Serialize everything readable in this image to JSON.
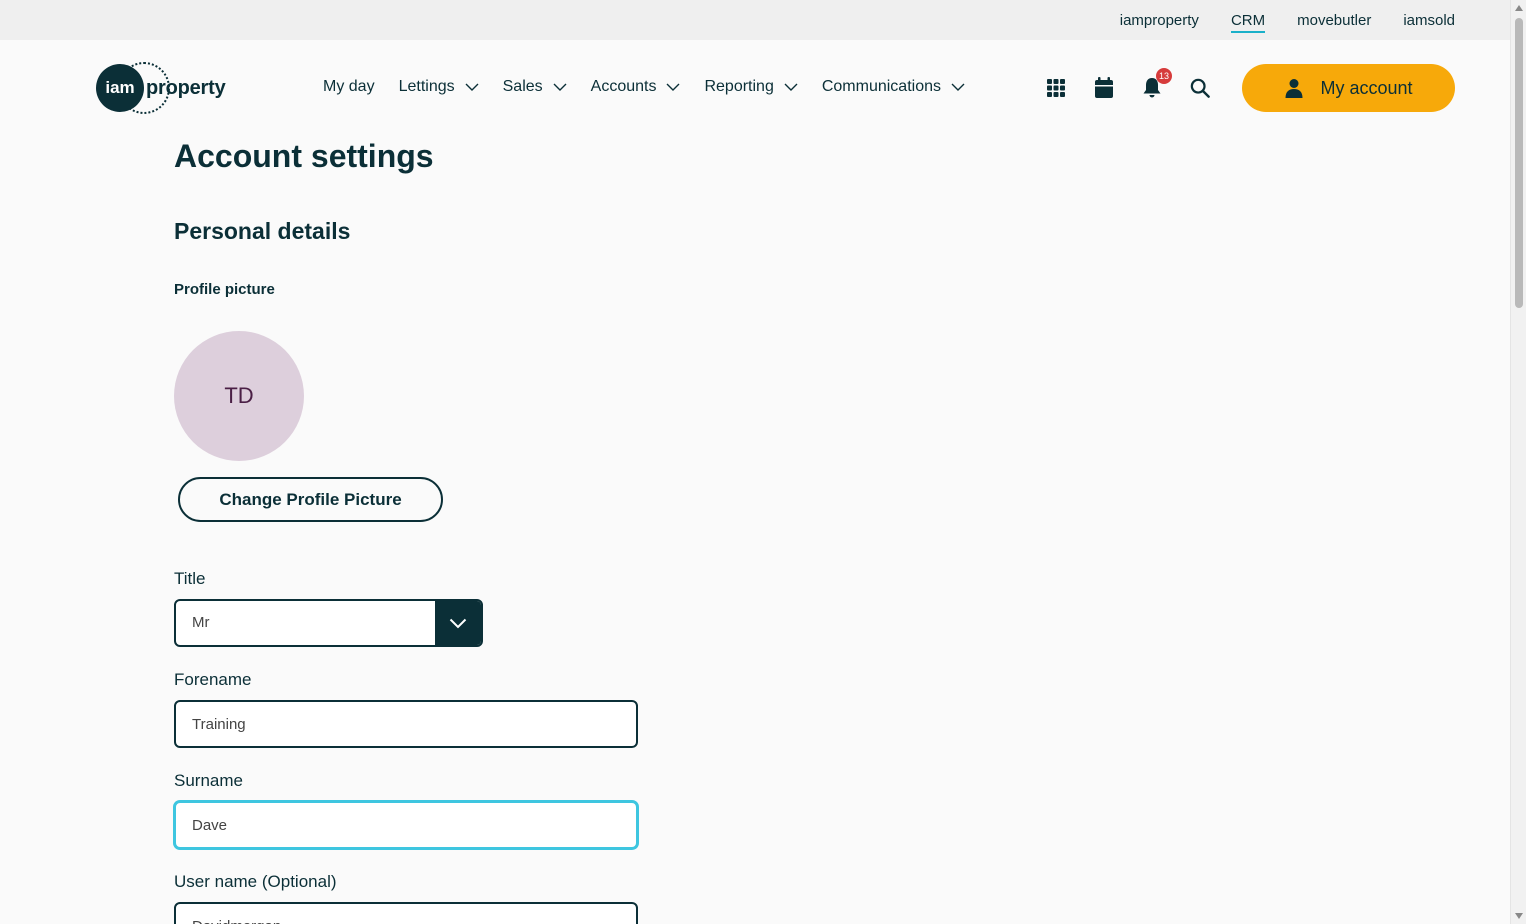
{
  "topbar": {
    "brands": [
      {
        "label": "iamproperty",
        "active": false
      },
      {
        "label": "CRM",
        "active": true
      },
      {
        "label": "movebutler",
        "active": false
      },
      {
        "label": "iamsold",
        "active": false
      }
    ]
  },
  "logo": {
    "badge_text": "iam",
    "word": "property"
  },
  "nav": {
    "items": [
      {
        "label": "My day",
        "has_dropdown": false
      },
      {
        "label": "Lettings",
        "has_dropdown": true
      },
      {
        "label": "Sales",
        "has_dropdown": true
      },
      {
        "label": "Accounts",
        "has_dropdown": true
      },
      {
        "label": "Reporting",
        "has_dropdown": true
      },
      {
        "label": "Communications",
        "has_dropdown": true
      }
    ]
  },
  "header_icons": {
    "apps": "grid-icon",
    "calendar": "calendar-icon",
    "notifications": "bell-icon",
    "notification_count": "13",
    "search": "search-icon"
  },
  "account_button": {
    "label": "My account",
    "icon": "user-icon"
  },
  "page": {
    "title": "Account settings",
    "section_title": "Personal details",
    "profile_picture_label": "Profile picture",
    "avatar_initials": "TD",
    "change_picture_label": "Change Profile Picture"
  },
  "form": {
    "title_label": "Title",
    "title_value": "Mr",
    "forename_label": "Forename",
    "forename_value": "Training",
    "surname_label": "Surname",
    "surname_value": "Dave",
    "username_label": "User name (Optional)",
    "username_value": "Davidmorgan"
  },
  "colors": {
    "primary": "#0b2f37",
    "accent": "#f7a90a",
    "focus": "#3ec6e0",
    "avatar_bg": "#ddcfdc",
    "badge": "#d63b3b"
  }
}
